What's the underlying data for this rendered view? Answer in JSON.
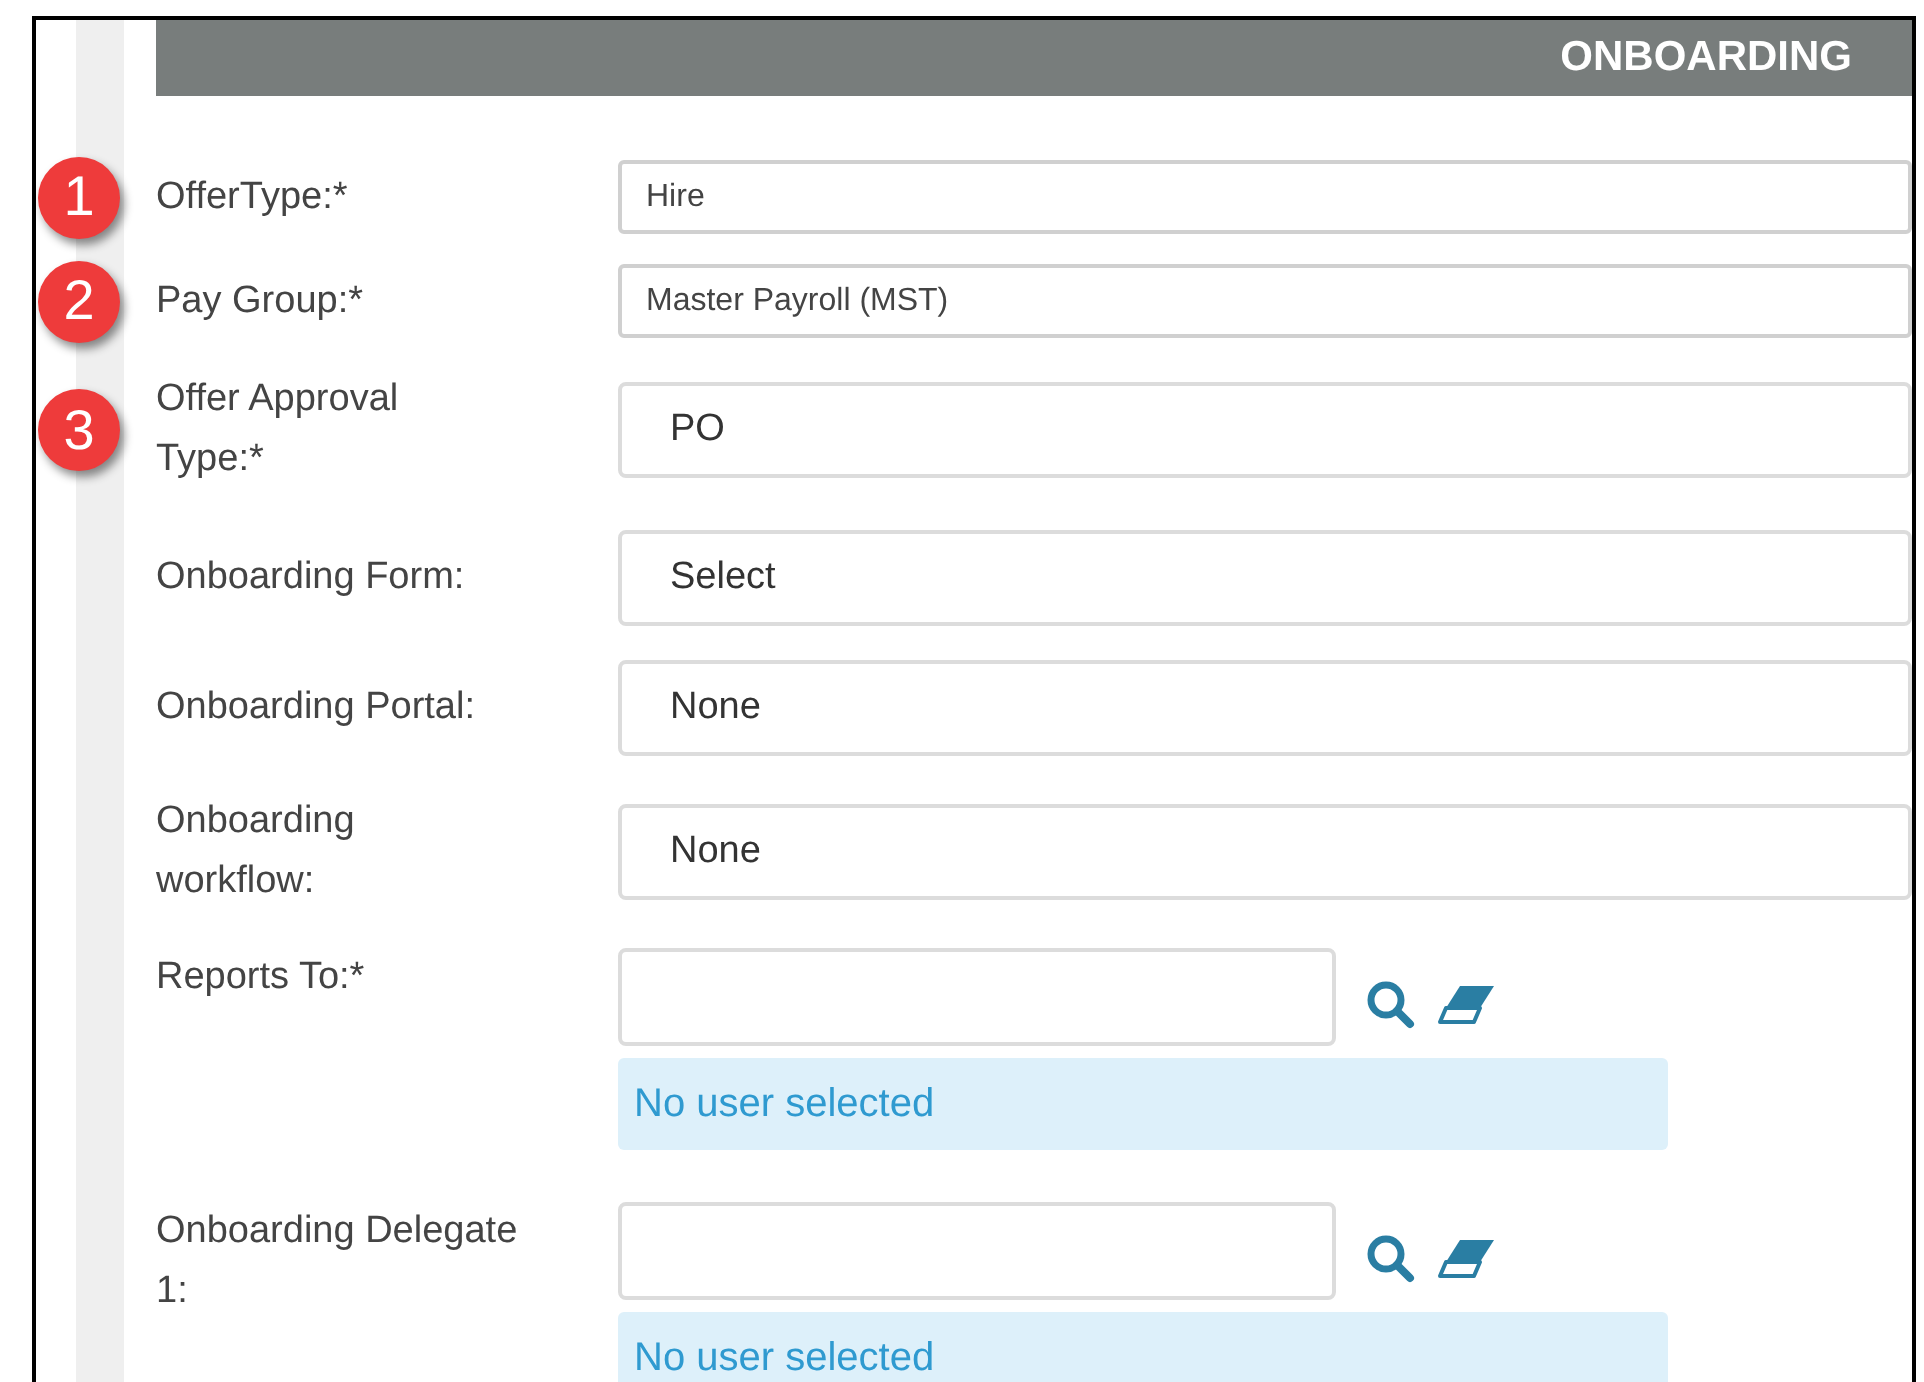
{
  "header": {
    "title": "ONBOARDING"
  },
  "fields": [
    {
      "kind": "compact",
      "badge": "1",
      "label": "OfferType:*",
      "value": "Hire"
    },
    {
      "kind": "compact",
      "badge": "2",
      "label": "Pay Group:*",
      "value": "Master Payroll (MST)"
    },
    {
      "kind": "select",
      "badge": "3",
      "label": "Offer Approval Type:*",
      "value": "PO"
    },
    {
      "kind": "select",
      "label": "Onboarding Form:",
      "value": "Select"
    },
    {
      "kind": "select",
      "label": "Onboarding Portal:",
      "value": "None"
    },
    {
      "kind": "select",
      "label": "Onboarding workflow:",
      "value": "None"
    },
    {
      "kind": "lookup",
      "label": "Reports To:*",
      "note": "No user selected"
    },
    {
      "kind": "lookup",
      "label": "Onboarding Delegate 1:",
      "note": "No user selected"
    }
  ]
}
